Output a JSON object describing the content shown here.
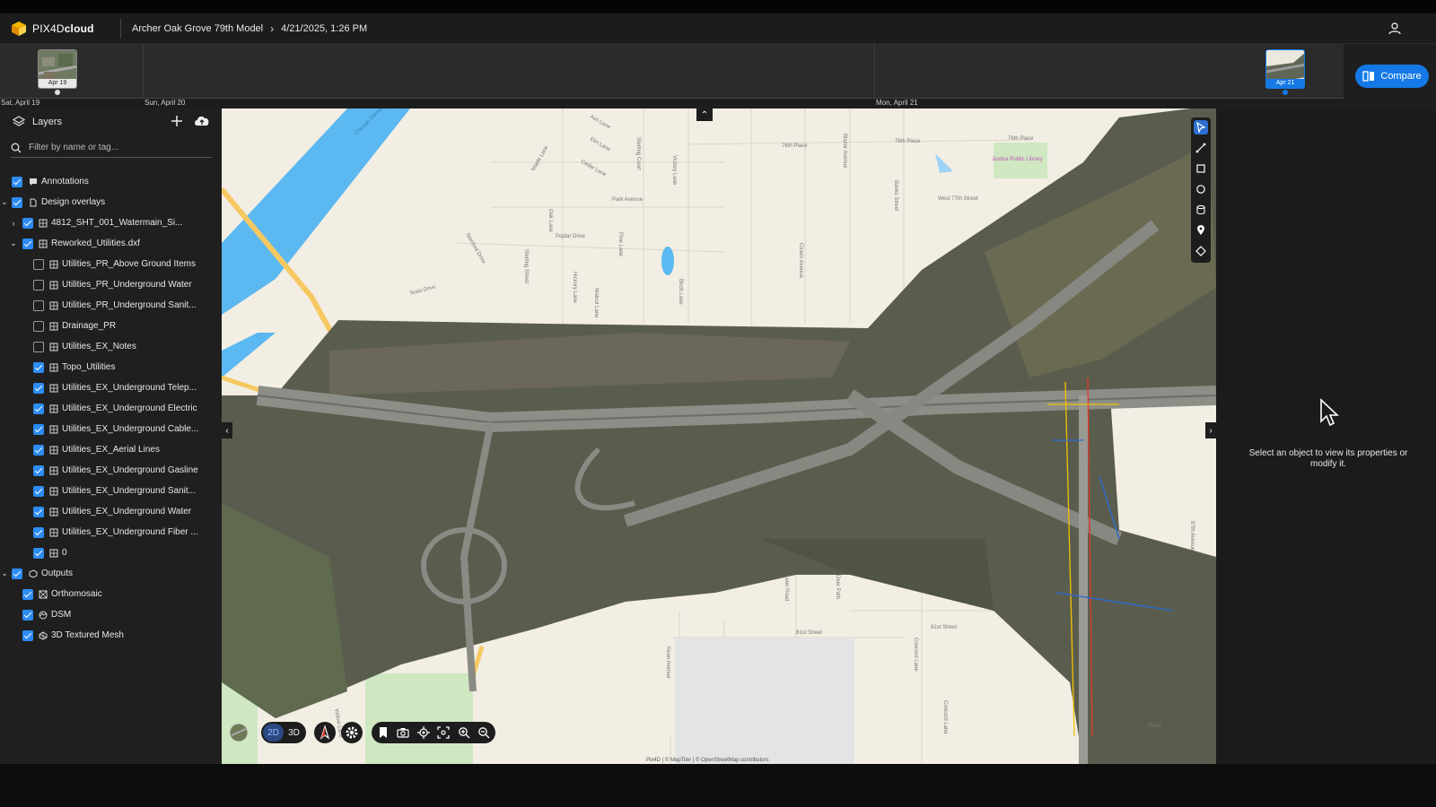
{
  "app": {
    "brand_light": "PIX4D",
    "brand_bold": "cloud",
    "project_name": "Archer Oak Grove 79th Model",
    "project_date": "4/21/2025, 1:26 PM"
  },
  "timeline": {
    "days": [
      "Sat, April 19",
      "Sun, April 20",
      "Mon, April 21"
    ],
    "captures": [
      {
        "label": "Apr 19",
        "active": false
      },
      {
        "label": "Apr 21",
        "active": true
      }
    ],
    "compare_label": "Compare"
  },
  "layers": {
    "title": "Layers",
    "filter_placeholder": "Filter by name or tag...",
    "items": [
      {
        "name": "Annotations",
        "checked": true
      },
      {
        "name": "Design overlays",
        "checked": true
      },
      {
        "name": "4812_SHT_001_Watermain_Si...",
        "checked": true
      },
      {
        "name": "Reworked_Utilities.dxf",
        "checked": true
      },
      {
        "name": "Utilities_PR_Above Ground Items",
        "checked": false
      },
      {
        "name": "Utilities_PR_Underground Water",
        "checked": false
      },
      {
        "name": "Utilities_PR_Underground Sanit...",
        "checked": false
      },
      {
        "name": "Drainage_PR",
        "checked": false
      },
      {
        "name": "Utilities_EX_Notes",
        "checked": false
      },
      {
        "name": "Topo_Utilities",
        "checked": true
      },
      {
        "name": "Utilities_EX_Underground Telep...",
        "checked": true
      },
      {
        "name": "Utilities_EX_Underground Electric",
        "checked": true
      },
      {
        "name": "Utilities_EX_Underground Cable...",
        "checked": true
      },
      {
        "name": "Utilities_EX_Aerial Lines",
        "checked": true
      },
      {
        "name": "Utilities_EX_Underground Gasline",
        "checked": true
      },
      {
        "name": "Utilities_EX_Underground Sanit...",
        "checked": true
      },
      {
        "name": "Utilities_EX_Underground Water",
        "checked": true
      },
      {
        "name": "Utilities_EX_Underground Fiber ...",
        "checked": true
      },
      {
        "name": "0",
        "checked": true
      },
      {
        "name": "Outputs",
        "checked": true
      },
      {
        "name": "Orthomosaic",
        "checked": true
      },
      {
        "name": "DSM",
        "checked": true
      },
      {
        "name": "3D Textured Mesh",
        "checked": true
      }
    ]
  },
  "map": {
    "view_2d": "2D",
    "view_3d": "3D",
    "attribution": "Pix4D | © MapTiler | © OpenStreetMap contributors",
    "streets": [
      "Chicago Sanitary",
      "Ash Lane",
      "Elm Lane",
      "Maple Lane",
      "Cedar Lane",
      "Sterling Court",
      "Victory Lane",
      "Park Avenue",
      "Poplar Drive",
      "Oak Lane",
      "Pine Lane",
      "Stanford Drive",
      "Sterling Street",
      "Tesla Drive",
      "Hickory Lane",
      "Walnut Lane",
      "Birch Lane",
      "76th Place",
      "76th Place",
      "76th Place",
      "Blazer Avenue",
      "Banks Street",
      "Cicero Avenue",
      "West 77th Street",
      "Justice Public Library",
      "81st Street",
      "81st Street",
      "Lenn Road",
      "Deer Path",
      "Kean Avenue",
      "Concord Lane",
      "Concord Lane",
      "Willow Lane",
      "87th Avenue",
      "Place"
    ]
  },
  "properties_panel": {
    "empty_message": "Select an object to view its properties or modify it."
  },
  "colors": {
    "accent": "#1479e6",
    "checkbox": "#2c8cf4",
    "water": "#5bb8f0",
    "panel": "#1f1f1f"
  }
}
